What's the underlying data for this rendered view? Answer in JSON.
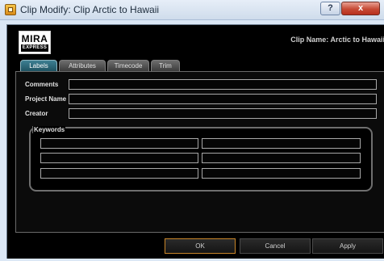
{
  "window": {
    "title": "Clip Modify: Clip Arctic to Hawaii",
    "help_label": "?",
    "close_label": "x"
  },
  "logo": {
    "top": "MIRA",
    "bottom": "EXPRESS"
  },
  "header": {
    "clip_name": "Clip Name: Arctic to Hawaii"
  },
  "tabs": [
    {
      "label": "Labels",
      "active": true
    },
    {
      "label": "Attributes",
      "active": false
    },
    {
      "label": "Timecode",
      "active": false
    },
    {
      "label": "Trim",
      "active": false
    }
  ],
  "fields": {
    "comments": {
      "label": "Comments",
      "value": ""
    },
    "project_name": {
      "label": "Project Name",
      "value": ""
    },
    "creator": {
      "label": "Creator",
      "value": ""
    }
  },
  "keywords": {
    "label": "Keywords",
    "values": [
      "",
      "",
      "",
      "",
      "",
      ""
    ]
  },
  "buttons": {
    "ok": "OK",
    "cancel": "Cancel",
    "apply": "Apply"
  },
  "colors": {
    "accent_tab": "#2b6a7c",
    "ok_border": "#c9862a",
    "close_red": "#c64a35"
  }
}
